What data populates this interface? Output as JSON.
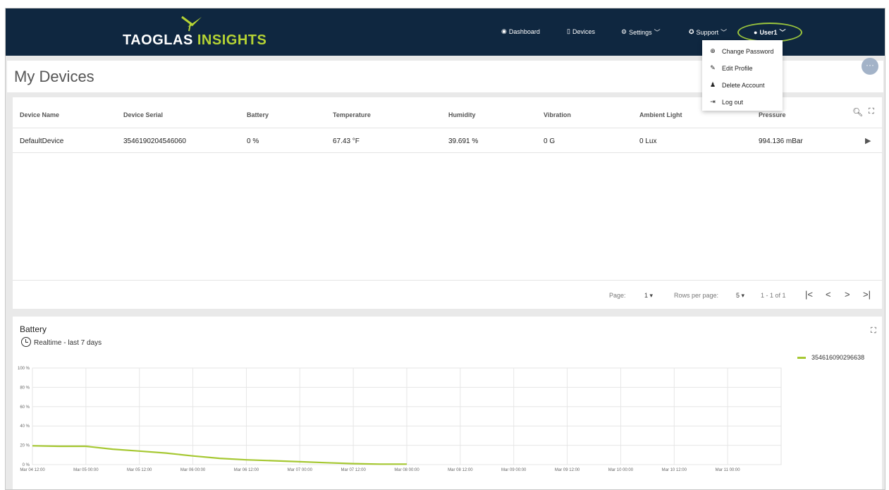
{
  "brand": {
    "part1": "TAOGLAS",
    "part2": "INSIGHTS"
  },
  "nav": {
    "dashboard": "Dashboard",
    "devices": "Devices",
    "settings": "Settings",
    "support": "Support",
    "user": "User1"
  },
  "user_menu": {
    "change_password": "Change Password",
    "edit_profile": "Edit Profile",
    "delete_account": "Delete Account",
    "log_out": "Log out"
  },
  "page": {
    "title": "My Devices",
    "more": "···"
  },
  "table": {
    "columns": [
      "Device Name",
      "Device Serial",
      "Battery",
      "Temperature",
      "Humidity",
      "Vibration",
      "Ambient Light",
      "Pressure"
    ],
    "rows": [
      [
        "DefaultDevice",
        "3546190204546060",
        "0 %",
        "67.43 °F",
        "39.691 %",
        "0 G",
        "0 Lux",
        "994.136 mBar"
      ]
    ]
  },
  "pagination": {
    "page_label": "Page:",
    "page_value": "1",
    "rows_label": "Rows per page:",
    "rows_value": "5",
    "range": "1 - 1 of 1",
    "first": "|<",
    "prev": "<",
    "next": ">",
    "last": ">|"
  },
  "colors": {
    "topbar": "#0f2740",
    "accent": "#b5d334",
    "series": "#a6c832"
  },
  "icons": {
    "dashboard": "dashboard-icon",
    "devices": "devices-icon",
    "settings": "gear-icon",
    "support": "support-icon",
    "user": "user-icon",
    "search": "search-icon",
    "expand": "expand-icon",
    "play": "play-icon",
    "clock": "clock-icon"
  },
  "chart_section": {
    "title": "Battery",
    "subtitle": "Realtime - last 7 days"
  },
  "chart_data": {
    "type": "line",
    "title": "Battery",
    "ylim": [
      0,
      100
    ],
    "y_ticks": [
      "0 %",
      "20 %",
      "40 %",
      "60 %",
      "80 %",
      "100 %"
    ],
    "x_ticks": [
      "Mar 04 12:00",
      "Mar 05 00:00",
      "Mar 05 12:00",
      "Mar 06 00:00",
      "Mar 06 12:00",
      "Mar 07 00:00",
      "Mar 07 12:00",
      "Mar 08 00:00",
      "Mar 08 12:00",
      "Mar 09 00:00",
      "Mar 09 12:00",
      "Mar 10 00:00",
      "Mar 10 12:00",
      "Mar 11 00:00"
    ],
    "grid": true,
    "legend_position": "right",
    "series": [
      {
        "name": "354616090296638",
        "x": [
          "Mar 04 12:00",
          "Mar 04 18:00",
          "Mar 05 00:00",
          "Mar 05 06:00",
          "Mar 05 12:00",
          "Mar 05 18:00",
          "Mar 06 00:00",
          "Mar 06 06:00",
          "Mar 06 12:00",
          "Mar 06 18:00",
          "Mar 07 00:00",
          "Mar 07 06:00",
          "Mar 07 12:00",
          "Mar 07 18:00",
          "Mar 08 00:00"
        ],
        "values": [
          19.5,
          19,
          19,
          16,
          14,
          12,
          9,
          6.5,
          5,
          4,
          3,
          2,
          1,
          0.5,
          0.5
        ]
      }
    ]
  }
}
